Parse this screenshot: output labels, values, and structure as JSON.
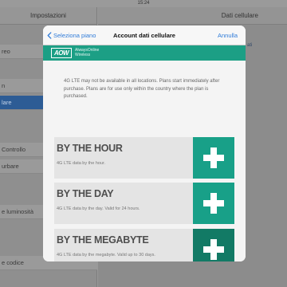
{
  "status_bar": {
    "time": "15:24"
  },
  "background": {
    "left_header": "Impostazioni",
    "right_header": "Dati cellulare",
    "rows": [
      {
        "label": "reo",
        "selected": false
      },
      {
        "label": "n",
        "selected": false
      },
      {
        "label": "lare",
        "selected": true
      },
      {
        "label": "Controllo",
        "selected": false
      },
      {
        "label": "urbare",
        "selected": false
      },
      {
        "label": "e luminosità",
        "selected": false
      },
      {
        "label": "e codice",
        "selected": false
      }
    ],
    "right_edge_text": "ati"
  },
  "modal": {
    "nav": {
      "back_label": "Seleziona piano",
      "title": "Account dati cellulare",
      "cancel_label": "Annulla"
    },
    "brand": {
      "logo_text": "AOW",
      "name_line1": "AlwaysOnline",
      "name_line2": "Wireless"
    },
    "intro": "4G LTE may not be available in all locations. Plans start immediately after purchase. Plans are for use only within the country where the plan is purchased.",
    "plans": [
      {
        "title": "BY THE HOUR",
        "description": "4G LTE data by the hour."
      },
      {
        "title": "BY THE DAY",
        "description": "4G LTE data by the day. Valid for 24 hours."
      },
      {
        "title": "BY THE MEGABYTE",
        "description": "4G LTE data by the megabyte. Valid up to 30 days."
      }
    ],
    "colors": {
      "brand": "#1c9f85",
      "link": "#2f7bd8",
      "add_button": "#18a088",
      "add_button_pressed": "#127a65"
    }
  }
}
